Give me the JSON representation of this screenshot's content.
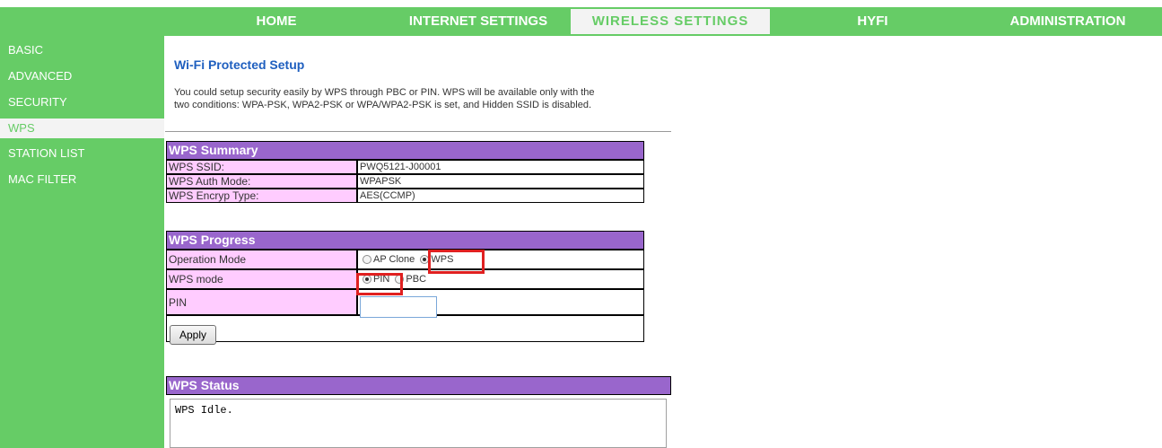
{
  "topnav": {
    "items": [
      {
        "label": "HOME",
        "active": false
      },
      {
        "label": "INTERNET SETTINGS",
        "active": false
      },
      {
        "label": "WIRELESS SETTINGS",
        "active": true
      },
      {
        "label": "HYFI",
        "active": false
      },
      {
        "label": "ADMINISTRATION",
        "active": false
      }
    ]
  },
  "sidebar": {
    "items": [
      {
        "label": "BASIC",
        "active": false
      },
      {
        "label": "ADVANCED",
        "active": false
      },
      {
        "label": "SECURITY",
        "active": false
      },
      {
        "label": "WPS",
        "active": true
      },
      {
        "label": "STATION LIST",
        "active": false
      },
      {
        "label": "MAC FILTER",
        "active": false
      }
    ]
  },
  "main": {
    "title": "Wi-Fi Protected Setup",
    "description_line1": "You could setup security easily by WPS through PBC or PIN. WPS will be available only with the",
    "description_line2": "two conditions: WPA-PSK, WPA2-PSK or WPA/WPA2-PSK is set, and Hidden SSID is disabled."
  },
  "summary": {
    "header": "WPS Summary",
    "ssid_label": "WPS SSID:",
    "ssid_value": "PWQ5121-J00001",
    "auth_label": "WPS Auth Mode:",
    "auth_value": "WPAPSK",
    "encryp_label": "WPS Encryp Type:",
    "encryp_value": "AES(CCMP)"
  },
  "progress": {
    "header": "WPS Progress",
    "operation_mode_label": "Operation Mode",
    "operation_options": [
      {
        "label": "AP Clone",
        "selected": false
      },
      {
        "label": "WPS",
        "selected": true
      }
    ],
    "wps_mode_label": "WPS mode",
    "wps_mode_options": [
      {
        "label": "PIN",
        "selected": true
      },
      {
        "label": "PBC",
        "selected": false
      }
    ],
    "pin_label": "PIN",
    "pin_value": "",
    "apply_label": "Apply"
  },
  "status": {
    "header": "WPS Status",
    "text": "WPS Idle."
  },
  "colors": {
    "nav_green": "#66cc66",
    "header_purple": "#9966cc",
    "label_pink": "#ffccff",
    "title_blue": "#1f5fbf",
    "highlight_red": "#e02020"
  }
}
